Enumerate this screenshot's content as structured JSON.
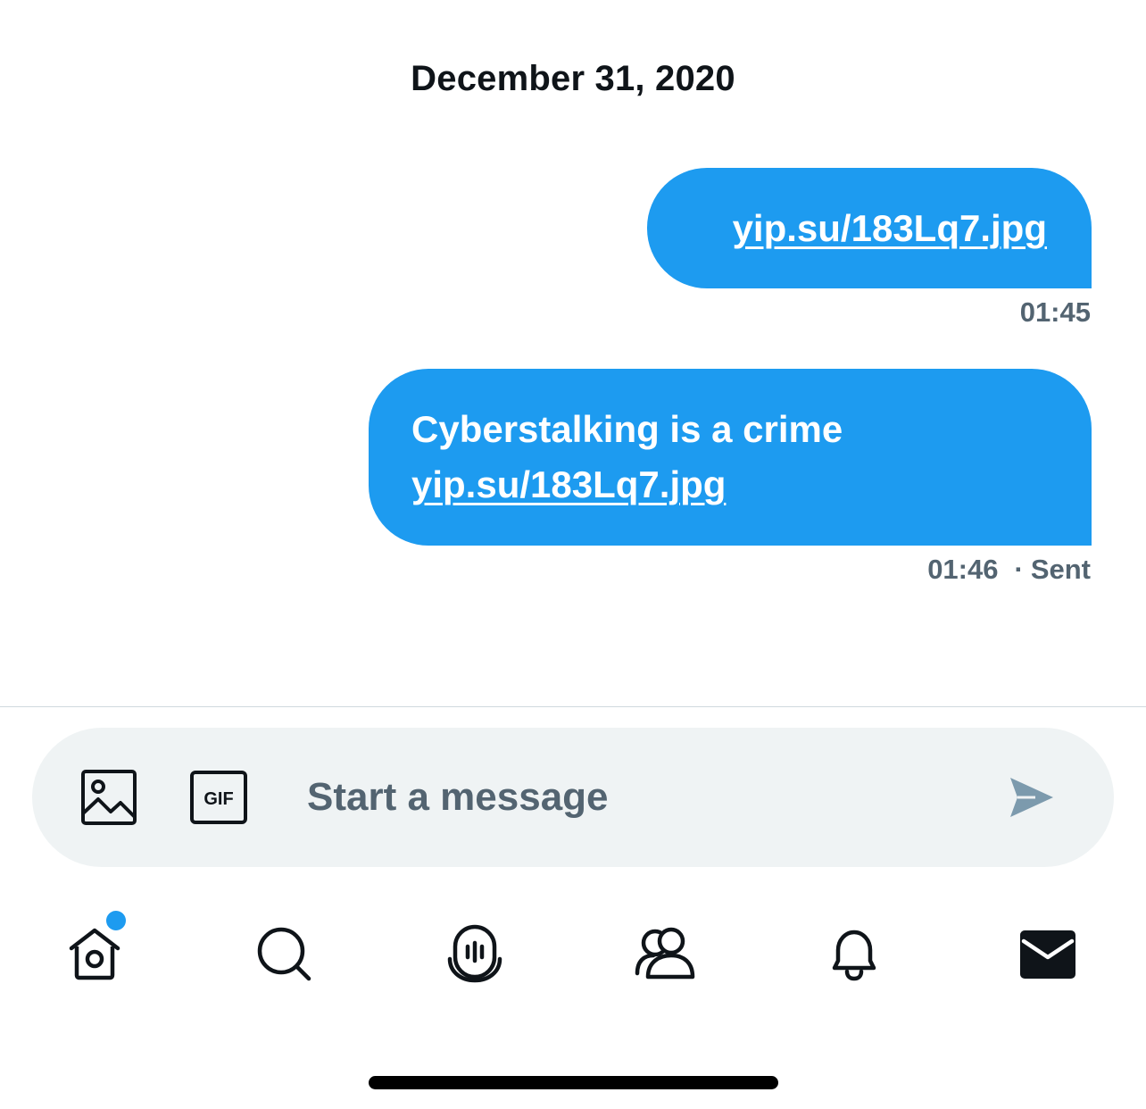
{
  "conversation": {
    "date_header": "December 31, 2020",
    "messages": [
      {
        "direction": "outgoing",
        "text_prefix": "",
        "link": "yip.su/183Lq7.jpg",
        "time": "01:45",
        "status": ""
      },
      {
        "direction": "outgoing",
        "text_prefix": "Cyberstalking is a crime ",
        "link": "yip.su/183Lq7.jpg",
        "time": "01:46",
        "status": "Sent",
        "separator": "·"
      }
    ]
  },
  "composer": {
    "placeholder": "Start a message",
    "media_icon": "image-icon",
    "gif_icon": "gif-icon",
    "gif_label": "GIF",
    "send_icon": "send-icon"
  },
  "tabbar": {
    "tabs": [
      {
        "icon": "home-icon",
        "has_notification_dot": true
      },
      {
        "icon": "search-icon"
      },
      {
        "icon": "spaces-icon"
      },
      {
        "icon": "communities-icon"
      },
      {
        "icon": "notifications-icon"
      },
      {
        "icon": "messages-icon",
        "active": true
      }
    ]
  },
  "colors": {
    "accent": "#1d9bf0",
    "text_primary": "#0f1419",
    "text_secondary": "#536471",
    "composer_bg": "#eff3f4",
    "divider": "#cfd9de"
  }
}
